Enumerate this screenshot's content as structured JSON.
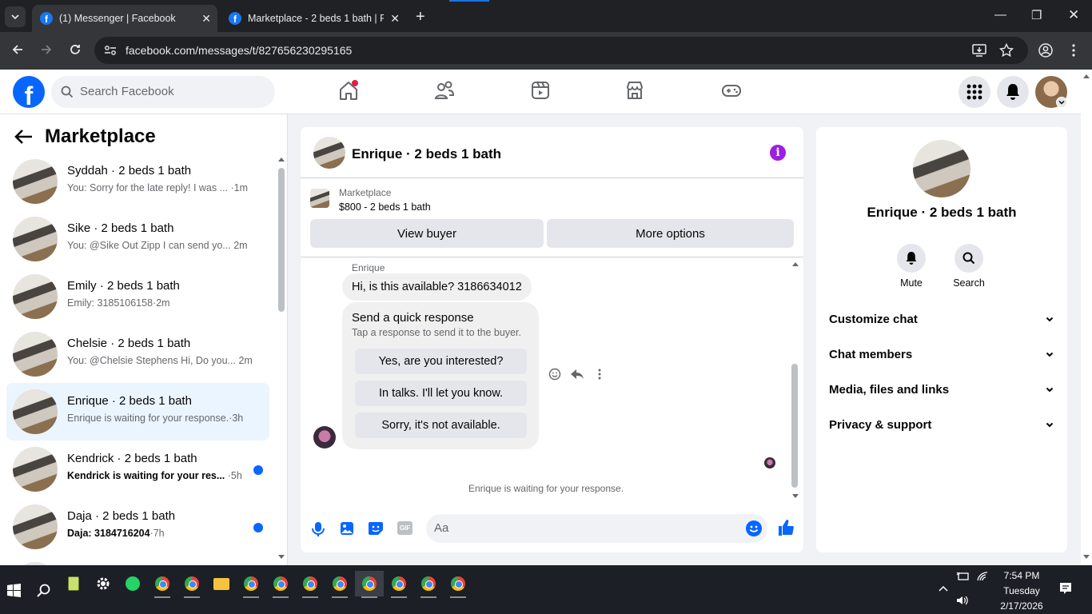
{
  "browser": {
    "tabs": [
      {
        "title": "(1) Messenger | Facebook",
        "active": true
      },
      {
        "title": "Marketplace - 2 beds 1 bath | Fa",
        "active": false
      }
    ],
    "url": "facebook.com/messages/t/827656230295165"
  },
  "fb_header": {
    "logo": "f",
    "search_placeholder": "Search Facebook",
    "nav_icons": [
      "home-icon",
      "friends-icon",
      "video-icon",
      "marketplace-icon",
      "gaming-icon"
    ],
    "home_has_notification": true
  },
  "sidebar": {
    "title": "Marketplace",
    "conversations": [
      {
        "name": "Syddah · 2 beds 1 bath",
        "preview": "You: Sorry for the late reply! I was ...",
        "time": "·1m",
        "unread": false,
        "selected": false
      },
      {
        "name": "Sike · 2 beds 1 bath",
        "preview": "You: @Sike Out Zipp I can send yo...",
        "time": "2m",
        "unread": false,
        "selected": false
      },
      {
        "name": "Emily · 2 beds 1 bath",
        "preview": "Emily: 3185106158",
        "time": "·2m",
        "unread": false,
        "selected": false
      },
      {
        "name": "Chelsie · 2 beds 1 bath",
        "preview": "You: @Chelsie Stephens Hi, Do you...",
        "time": "2m",
        "unread": false,
        "selected": false
      },
      {
        "name": "Enrique · 2 beds 1 bath",
        "preview": "Enrique is waiting for your response.",
        "time": "·3h",
        "unread": false,
        "selected": true
      },
      {
        "name": "Kendrick · 2 beds 1 bath",
        "preview": "Kendrick is waiting for your res...",
        "time": "·5h",
        "unread": true,
        "selected": false
      },
      {
        "name": "Daja · 2 beds 1 bath",
        "preview": "Daja: 3184716204",
        "time": "·7h",
        "unread": true,
        "selected": false
      }
    ]
  },
  "chat": {
    "title": "Enrique · 2 beds 1 bath",
    "marketplace_label": "Marketplace",
    "listing": "$800 - 2 beds 1 bath",
    "view_buyer": "View buyer",
    "more_options": "More options",
    "sender": "Enrique",
    "message": "Hi, is this available? 3186634012",
    "quick_title": "Send a quick response",
    "quick_sub": "Tap a response to send it to the buyer.",
    "quick_options": [
      "Yes, are you interested?",
      "In talks. I'll let you know.",
      "Sorry, it's not available."
    ],
    "waiting": "Enrique is waiting for your response.",
    "composer_placeholder": "Aa",
    "gif_label": "GIF"
  },
  "info_panel": {
    "name": "Enrique · 2 beds 1 bath",
    "mute": "Mute",
    "search": "Search",
    "sections": [
      "Customize chat",
      "Chat members",
      "Media, files and links",
      "Privacy & support"
    ]
  },
  "taskbar": {
    "time": "7:54 PM",
    "day": "Tuesday",
    "date": "2/17/2026"
  },
  "colors": {
    "fb_blue": "#0866ff",
    "selected_bg": "#ebf5ff",
    "info_purple": "#9c1fe0"
  }
}
